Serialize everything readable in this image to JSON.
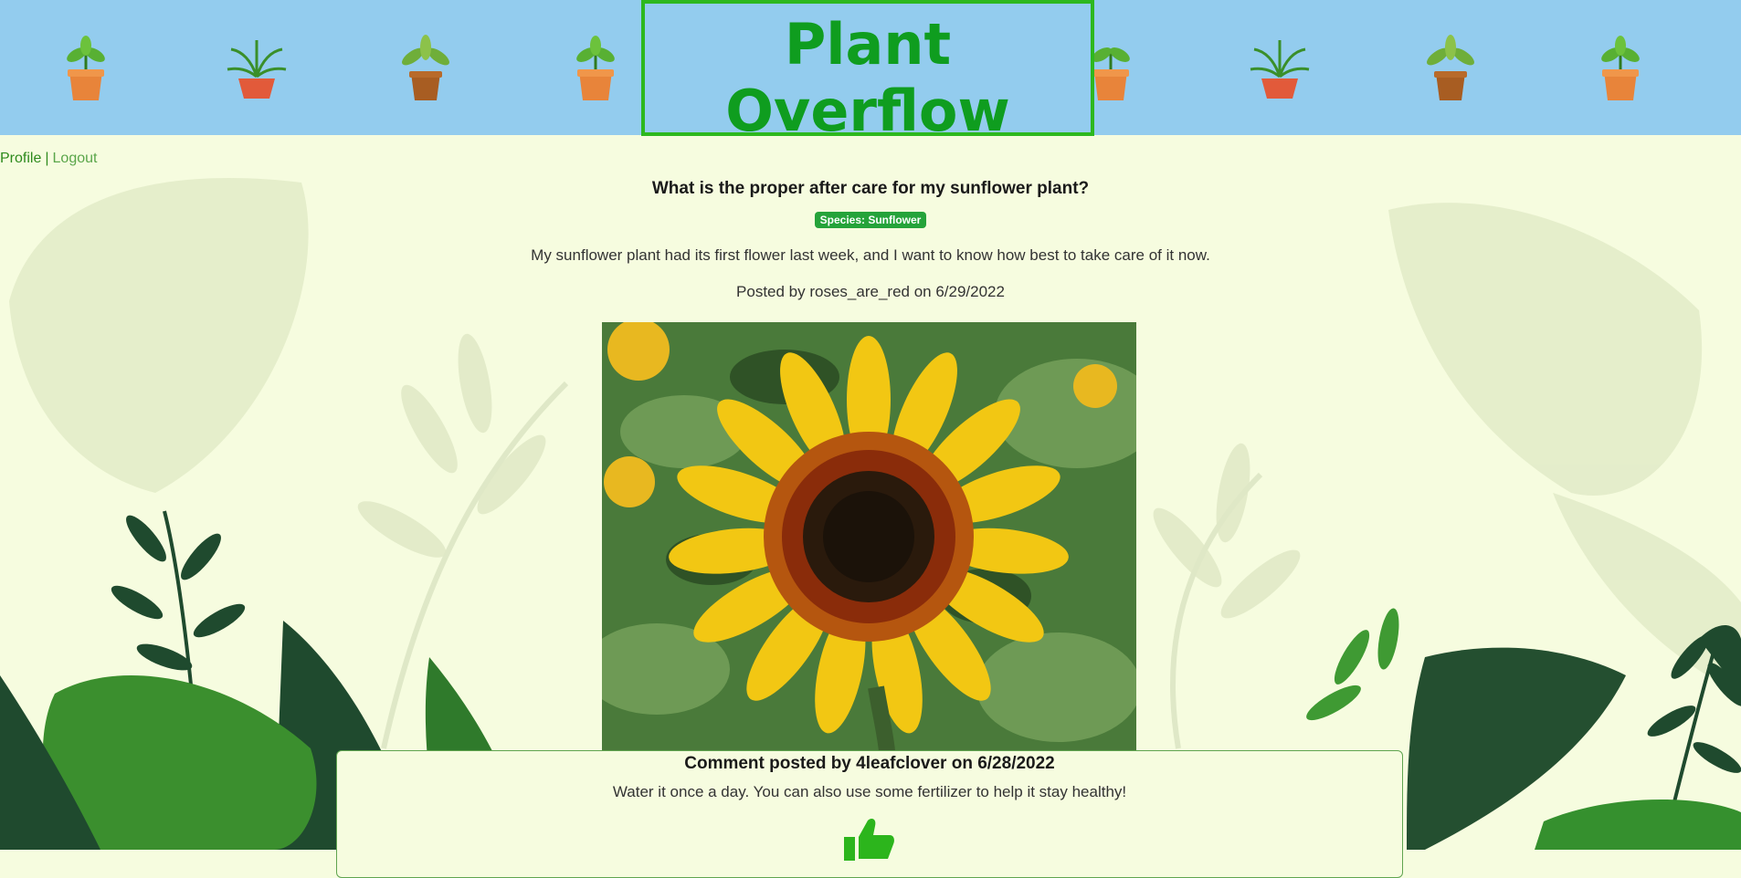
{
  "header": {
    "title": "Plant Overflow",
    "plant_icons": [
      "potted-plant-icon",
      "fern-plant-icon",
      "potted-plant-icon",
      "potted-plant-icon",
      "potted-plant-icon",
      "fern-plant-icon",
      "potted-plant-icon",
      "potted-plant-icon"
    ]
  },
  "nav": {
    "profile_label": "Profile",
    "separator": "|",
    "logout_label": "Logout"
  },
  "post": {
    "title": "What is the proper after care for my sunflower plant?",
    "species_badge": "Species: Sunflower",
    "body": "My sunflower plant had its first flower last week, and I want to know how best to take care of it now.",
    "meta": "Posted by roses_are_red on 6/29/2022"
  },
  "comment": {
    "header": "Comment posted by 4leafclover on 6/28/2022",
    "body": "Water it once a day. You can also use some fertilizer to help it stay healthy!",
    "like_icon": "thumbs-up-icon"
  },
  "colors": {
    "header_bg": "#93ccee",
    "title_green": "#0f9d1f",
    "page_bg": "#f6fcdf",
    "badge_green": "#25a33a"
  }
}
